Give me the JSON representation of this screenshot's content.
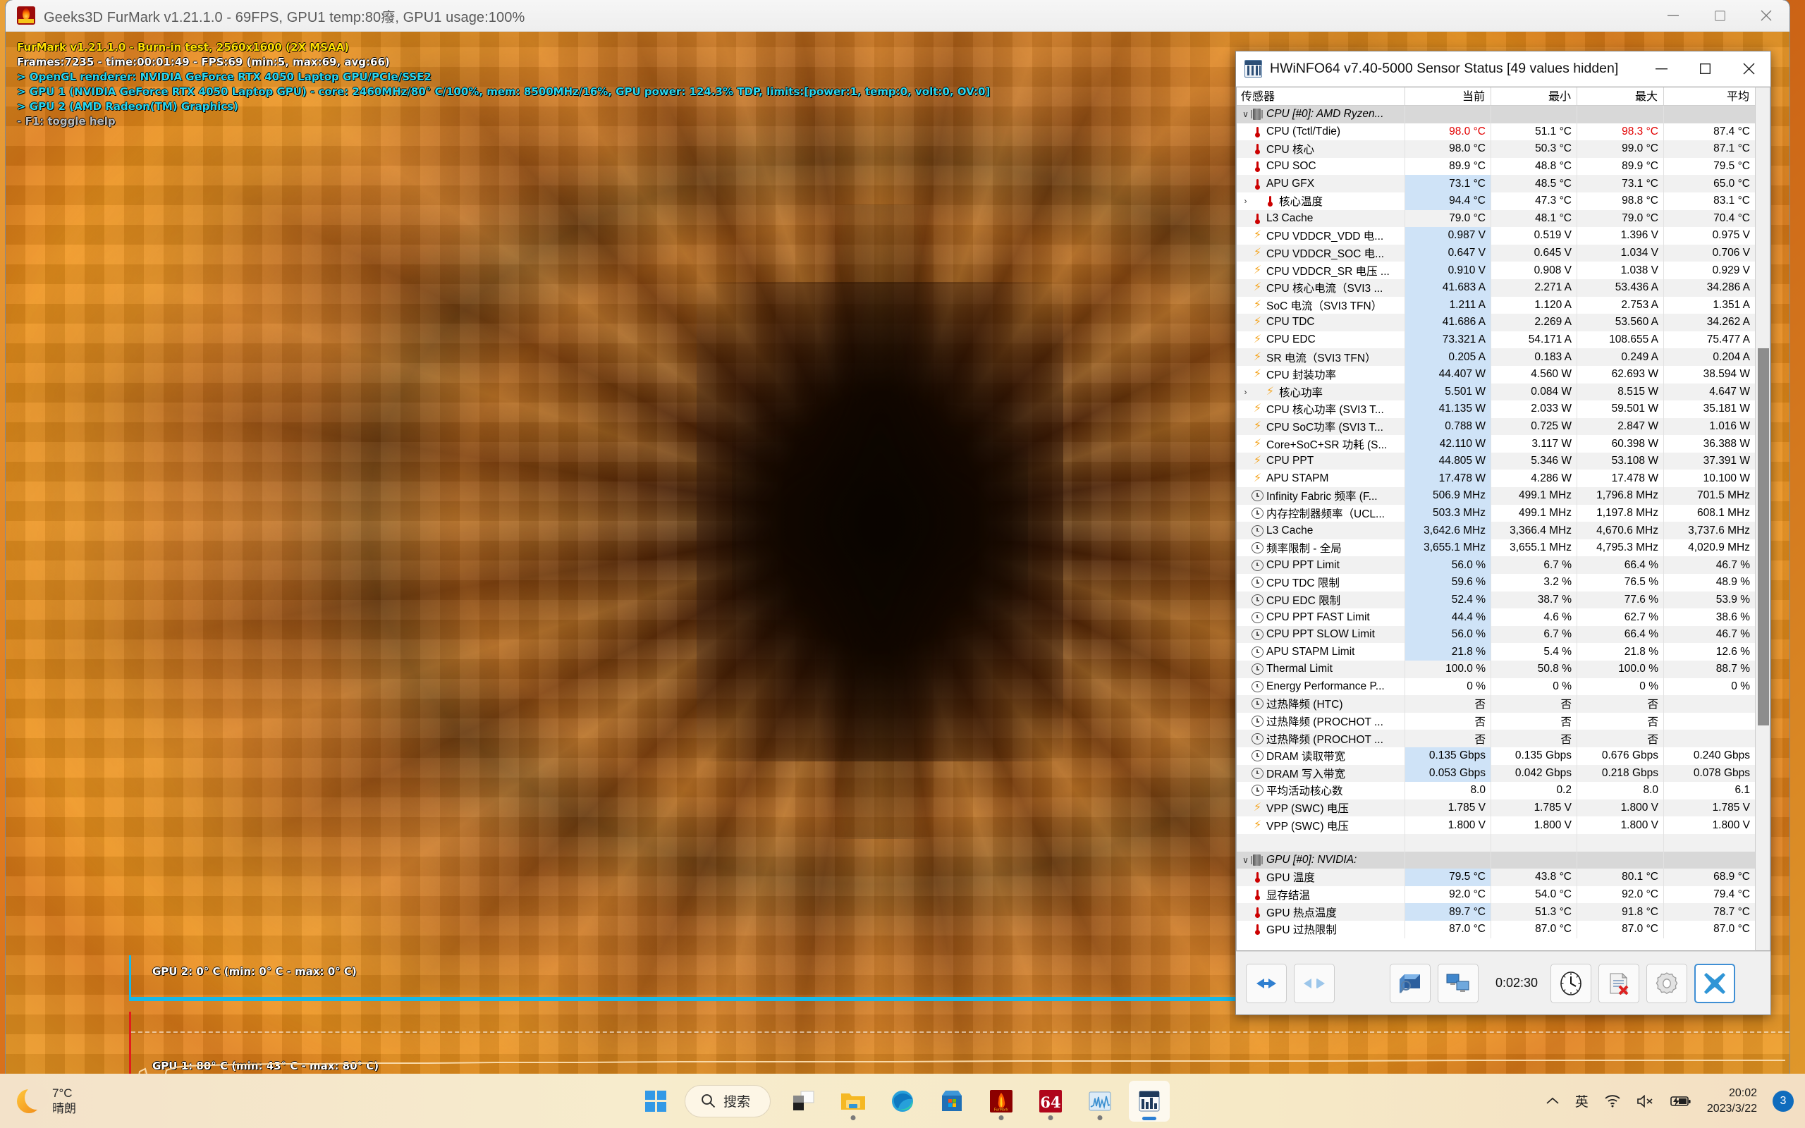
{
  "furmark": {
    "title": "Geeks3D FurMark v1.21.1.0 - 69FPS, GPU1 temp:80癈, GPU1 usage:100%",
    "icon": "furmark-icon",
    "window_buttons": {
      "minimize": "—",
      "maximize": "▢",
      "close": "✕"
    },
    "overlay": {
      "line1": "FurMark v1.21.1.0 - Burn-in test, 2560x1600 (2X MSAA)",
      "line2": "Frames:7235 - time:00:01:49 - FPS:69 (min:5, max:69, avg:66)",
      "line3": "> OpenGL renderer: NVIDIA GeForce RTX 4050 Laptop GPU/PCIe/SSE2",
      "line4": "> GPU 1 (NVIDIA GeForce RTX 4050 Laptop GPU) - core: 2460MHz/80° C/100%, mem: 8500MHz/16%, GPU power: 124.3% TDP, limits:[power:1, temp:0, volt:0, OV:0]",
      "line5": "> GPU 2 (AMD Radeon(TM) Graphics)",
      "line6": "- F1: toggle help"
    },
    "graphs": {
      "gpu2_label": "GPU 2: 0° C (min: 0° C - max: 0° C)",
      "gpu1_label": "GPU 1: 80° C (min: 43° C - max: 80° C)",
      "gpu2_color": "#17b8e8",
      "gpu1_color": "#e21b1b"
    }
  },
  "hwinfo": {
    "title": "HWiNFO64 v7.40-5000 Sensor Status [49 values hidden]",
    "icon": "hwinfo-icon",
    "window_buttons": {
      "minimize": "—",
      "maximize": "▢",
      "close": "✕"
    },
    "columns": [
      "传感器",
      "当前",
      "最小",
      "最大",
      "平均"
    ],
    "rows": [
      {
        "type": "group",
        "icon": "chip-icon",
        "expander": "chevron-down-icon",
        "name": "CPU [#0]: AMD Ryzen...",
        "cur": "",
        "min": "",
        "max": "",
        "avg": ""
      },
      {
        "type": "row",
        "icon": "thermometer-icon",
        "name": "CPU (Tctl/Tdie)",
        "cur": "98.0 °C",
        "min": "51.1 °C",
        "max": "98.3 °C",
        "avg": "87.4 °C",
        "cur_hot": true,
        "max_hot": true
      },
      {
        "type": "row",
        "icon": "thermometer-icon",
        "name": "CPU 核心",
        "cur": "98.0 °C",
        "min": "50.3 °C",
        "max": "99.0 °C",
        "avg": "87.1 °C"
      },
      {
        "type": "row",
        "icon": "thermometer-icon",
        "name": "CPU SOC",
        "cur": "89.9 °C",
        "min": "48.8 °C",
        "max": "89.9 °C",
        "avg": "79.5 °C"
      },
      {
        "type": "row",
        "icon": "thermometer-icon",
        "name": "APU GFX",
        "cur": "73.1 °C",
        "min": "48.5 °C",
        "max": "73.1 °C",
        "avg": "65.0 °C",
        "hl": true
      },
      {
        "type": "row",
        "icon": "thermometer-icon",
        "expander": "chevron-right-icon",
        "indent": true,
        "name": "核心温度",
        "cur": "94.4 °C",
        "min": "47.3 °C",
        "max": "98.8 °C",
        "avg": "83.1 °C",
        "hl": true
      },
      {
        "type": "row",
        "icon": "thermometer-icon",
        "name": "L3 Cache",
        "cur": "79.0 °C",
        "min": "48.1 °C",
        "max": "79.0 °C",
        "avg": "70.4 °C"
      },
      {
        "type": "row",
        "icon": "bolt-icon",
        "name": "CPU VDDCR_VDD 电...",
        "cur": "0.987 V",
        "min": "0.519 V",
        "max": "1.396 V",
        "avg": "0.975 V",
        "hl": true
      },
      {
        "type": "row",
        "icon": "bolt-icon",
        "name": "CPU VDDCR_SOC 电...",
        "cur": "0.647 V",
        "min": "0.645 V",
        "max": "1.034 V",
        "avg": "0.706 V",
        "hl": true
      },
      {
        "type": "row",
        "icon": "bolt-icon",
        "name": "CPU VDDCR_SR 电压 ...",
        "cur": "0.910 V",
        "min": "0.908 V",
        "max": "1.038 V",
        "avg": "0.929 V",
        "hl": true
      },
      {
        "type": "row",
        "icon": "bolt-icon",
        "name": "CPU 核心电流（SVI3 ...",
        "cur": "41.683 A",
        "min": "2.271 A",
        "max": "53.436 A",
        "avg": "34.286 A",
        "hl": true
      },
      {
        "type": "row",
        "icon": "bolt-icon",
        "name": "SoC 电流（SVI3 TFN）",
        "cur": "1.211 A",
        "min": "1.120 A",
        "max": "2.753 A",
        "avg": "1.351 A",
        "hl": true
      },
      {
        "type": "row",
        "icon": "bolt-icon",
        "name": "CPU TDC",
        "cur": "41.686 A",
        "min": "2.269 A",
        "max": "53.560 A",
        "avg": "34.262 A",
        "hl": true
      },
      {
        "type": "row",
        "icon": "bolt-icon",
        "name": "CPU EDC",
        "cur": "73.321 A",
        "min": "54.171 A",
        "max": "108.655 A",
        "avg": "75.477 A",
        "hl": true
      },
      {
        "type": "row",
        "icon": "bolt-icon",
        "name": "SR 电流（SVI3 TFN）",
        "cur": "0.205 A",
        "min": "0.183 A",
        "max": "0.249 A",
        "avg": "0.204 A",
        "hl": true
      },
      {
        "type": "row",
        "icon": "bolt-icon",
        "name": "CPU 封装功率",
        "cur": "44.407 W",
        "min": "4.560 W",
        "max": "62.693 W",
        "avg": "38.594 W",
        "hl": true
      },
      {
        "type": "row",
        "icon": "bolt-icon",
        "expander": "chevron-right-icon",
        "indent": true,
        "name": "核心功率",
        "cur": "5.501 W",
        "min": "0.084 W",
        "max": "8.515 W",
        "avg": "4.647 W",
        "hl": true
      },
      {
        "type": "row",
        "icon": "bolt-icon",
        "name": "CPU 核心功率 (SVI3 T...",
        "cur": "41.135 W",
        "min": "2.033 W",
        "max": "59.501 W",
        "avg": "35.181 W",
        "hl": true
      },
      {
        "type": "row",
        "icon": "bolt-icon",
        "name": "CPU SoC功率 (SVI3 T...",
        "cur": "0.788 W",
        "min": "0.725 W",
        "max": "2.847 W",
        "avg": "1.016 W",
        "hl": true
      },
      {
        "type": "row",
        "icon": "bolt-icon",
        "name": "Core+SoC+SR 功耗 (S...",
        "cur": "42.110 W",
        "min": "3.117 W",
        "max": "60.398 W",
        "avg": "36.388 W",
        "hl": true
      },
      {
        "type": "row",
        "icon": "bolt-icon",
        "name": "CPU PPT",
        "cur": "44.805 W",
        "min": "5.346 W",
        "max": "53.108 W",
        "avg": "37.391 W",
        "hl": true
      },
      {
        "type": "row",
        "icon": "bolt-icon",
        "name": "APU STAPM",
        "cur": "17.478 W",
        "min": "4.286 W",
        "max": "17.478 W",
        "avg": "10.100 W",
        "hl": true
      },
      {
        "type": "row",
        "icon": "clock-icon",
        "name": "Infinity Fabric 频率 (F...",
        "cur": "506.9 MHz",
        "min": "499.1 MHz",
        "max": "1,796.8 MHz",
        "avg": "701.5 MHz",
        "hl": true
      },
      {
        "type": "row",
        "icon": "clock-icon",
        "name": "内存控制器频率（UCL...",
        "cur": "503.3 MHz",
        "min": "499.1 MHz",
        "max": "1,197.8 MHz",
        "avg": "608.1 MHz",
        "hl": true
      },
      {
        "type": "row",
        "icon": "clock-icon",
        "name": "L3 Cache",
        "cur": "3,642.6 MHz",
        "min": "3,366.4 MHz",
        "max": "4,670.6 MHz",
        "avg": "3,737.6 MHz",
        "hl": true
      },
      {
        "type": "row",
        "icon": "clock-icon",
        "name": "频率限制 - 全局",
        "cur": "3,655.1 MHz",
        "min": "3,655.1 MHz",
        "max": "4,795.3 MHz",
        "avg": "4,020.9 MHz",
        "hl": true
      },
      {
        "type": "row",
        "icon": "clock-icon",
        "name": "CPU PPT Limit",
        "cur": "56.0 %",
        "min": "6.7 %",
        "max": "66.4 %",
        "avg": "46.7 %",
        "hl": true
      },
      {
        "type": "row",
        "icon": "clock-icon",
        "name": "CPU TDC 限制",
        "cur": "59.6 %",
        "min": "3.2 %",
        "max": "76.5 %",
        "avg": "48.9 %",
        "hl": true
      },
      {
        "type": "row",
        "icon": "clock-icon",
        "name": "CPU EDC 限制",
        "cur": "52.4 %",
        "min": "38.7 %",
        "max": "77.6 %",
        "avg": "53.9 %",
        "hl": true
      },
      {
        "type": "row",
        "icon": "clock-icon",
        "name": "CPU PPT FAST Limit",
        "cur": "44.4 %",
        "min": "4.6 %",
        "max": "62.7 %",
        "avg": "38.6 %",
        "hl": true
      },
      {
        "type": "row",
        "icon": "clock-icon",
        "name": "CPU PPT SLOW Limit",
        "cur": "56.0 %",
        "min": "6.7 %",
        "max": "66.4 %",
        "avg": "46.7 %",
        "hl": true
      },
      {
        "type": "row",
        "icon": "clock-icon",
        "name": "APU STAPM Limit",
        "cur": "21.8 %",
        "min": "5.4 %",
        "max": "21.8 %",
        "avg": "12.6 %",
        "hl": true
      },
      {
        "type": "row",
        "icon": "clock-icon",
        "name": "Thermal Limit",
        "cur": "100.0 %",
        "min": "50.8 %",
        "max": "100.0 %",
        "avg": "88.7 %"
      },
      {
        "type": "row",
        "icon": "clock-icon",
        "name": "Energy Performance P...",
        "cur": "0 %",
        "min": "0 %",
        "max": "0 %",
        "avg": "0 %"
      },
      {
        "type": "row",
        "icon": "clock-icon",
        "name": "过热降频 (HTC)",
        "cur": "否",
        "min": "否",
        "max": "否",
        "avg": ""
      },
      {
        "type": "row",
        "icon": "clock-icon",
        "name": "过热降频 (PROCHOT ...",
        "cur": "否",
        "min": "否",
        "max": "否",
        "avg": ""
      },
      {
        "type": "row",
        "icon": "clock-icon",
        "name": "过热降频 (PROCHOT ...",
        "cur": "否",
        "min": "否",
        "max": "否",
        "avg": ""
      },
      {
        "type": "row",
        "icon": "clock-icon",
        "name": "DRAM 读取带宽",
        "cur": "0.135 Gbps",
        "min": "0.135 Gbps",
        "max": "0.676 Gbps",
        "avg": "0.240 Gbps",
        "hl": true
      },
      {
        "type": "row",
        "icon": "clock-icon",
        "name": "DRAM 写入带宽",
        "cur": "0.053 Gbps",
        "min": "0.042 Gbps",
        "max": "0.218 Gbps",
        "avg": "0.078 Gbps",
        "hl": true
      },
      {
        "type": "row",
        "icon": "clock-icon",
        "name": "平均活动核心数",
        "cur": "8.0",
        "min": "0.2",
        "max": "8.0",
        "avg": "6.1"
      },
      {
        "type": "row",
        "icon": "bolt-icon",
        "name": "VPP (SWC) 电压",
        "cur": "1.785 V",
        "min": "1.785 V",
        "max": "1.800 V",
        "avg": "1.785 V"
      },
      {
        "type": "row",
        "icon": "bolt-icon",
        "name": "VPP (SWC) 电压",
        "cur": "1.800 V",
        "min": "1.800 V",
        "max": "1.800 V",
        "avg": "1.800 V"
      },
      {
        "type": "blank",
        "name": "",
        "cur": "",
        "min": "",
        "max": "",
        "avg": ""
      },
      {
        "type": "group",
        "icon": "chip-icon",
        "expander": "chevron-down-icon",
        "name": "GPU [#0]: NVIDIA:",
        "cur": "",
        "min": "",
        "max": "",
        "avg": ""
      },
      {
        "type": "row",
        "icon": "thermometer-icon",
        "name": "GPU 温度",
        "cur": "79.5 °C",
        "min": "43.8 °C",
        "max": "80.1 °C",
        "avg": "68.9 °C",
        "hl": true
      },
      {
        "type": "row",
        "icon": "thermometer-icon",
        "name": "显存结温",
        "cur": "92.0 °C",
        "min": "54.0 °C",
        "max": "92.0 °C",
        "avg": "79.4 °C"
      },
      {
        "type": "row",
        "icon": "thermometer-icon",
        "name": "GPU 热点温度",
        "cur": "89.7 °C",
        "min": "51.3 °C",
        "max": "91.8 °C",
        "avg": "78.7 °C",
        "hl": true
      },
      {
        "type": "row",
        "icon": "thermometer-icon",
        "name": "GPU 过热限制",
        "cur": "87.0 °C",
        "min": "87.0 °C",
        "max": "87.0 °C",
        "avg": "87.0 °C"
      }
    ],
    "toolbar": {
      "expand_label": "expand-columns-icon",
      "collapse_label": "collapse-columns-icon",
      "preferences_label": "sensor-preview-icon",
      "remote_label": "remote-monitor-icon",
      "elapsed": "0:02:30",
      "clock_label": "reset-timer-icon",
      "log_label": "logging-icon",
      "settings_label": "settings-gear-icon",
      "close_label": "close-x-icon"
    }
  },
  "taskbar": {
    "weather": {
      "temp": "7°C",
      "condition": "晴朗",
      "icon": "moon-icon"
    },
    "start": "start-button",
    "search": {
      "placeholder": "搜索",
      "icon": "search-icon"
    },
    "apps": [
      {
        "name": "task-view",
        "label": "任务视图",
        "running": false
      },
      {
        "name": "file-explorer",
        "label": "文件资源管理器",
        "running": true
      },
      {
        "name": "microsoft-edge",
        "label": "Microsoft Edge",
        "running": false
      },
      {
        "name": "microsoft-store",
        "label": "Microsoft Store",
        "running": false
      },
      {
        "name": "furmark",
        "label": "FurMark",
        "running": true
      },
      {
        "name": "hwinfo64",
        "label": "HWiNFO64",
        "running": true
      },
      {
        "name": "performance-monitor",
        "label": "性能监视器",
        "running": true
      },
      {
        "name": "hwinfo-sensors",
        "label": "HWiNFO Sensors",
        "running": true,
        "active": true
      }
    ],
    "tray": {
      "overflow": "︿",
      "ime": "英",
      "wifi": "wifi-icon",
      "volume": "volume-muted-icon",
      "battery": "battery-charging-icon",
      "time": "20:02",
      "date": "2023/3/22",
      "notifications": "3"
    }
  }
}
